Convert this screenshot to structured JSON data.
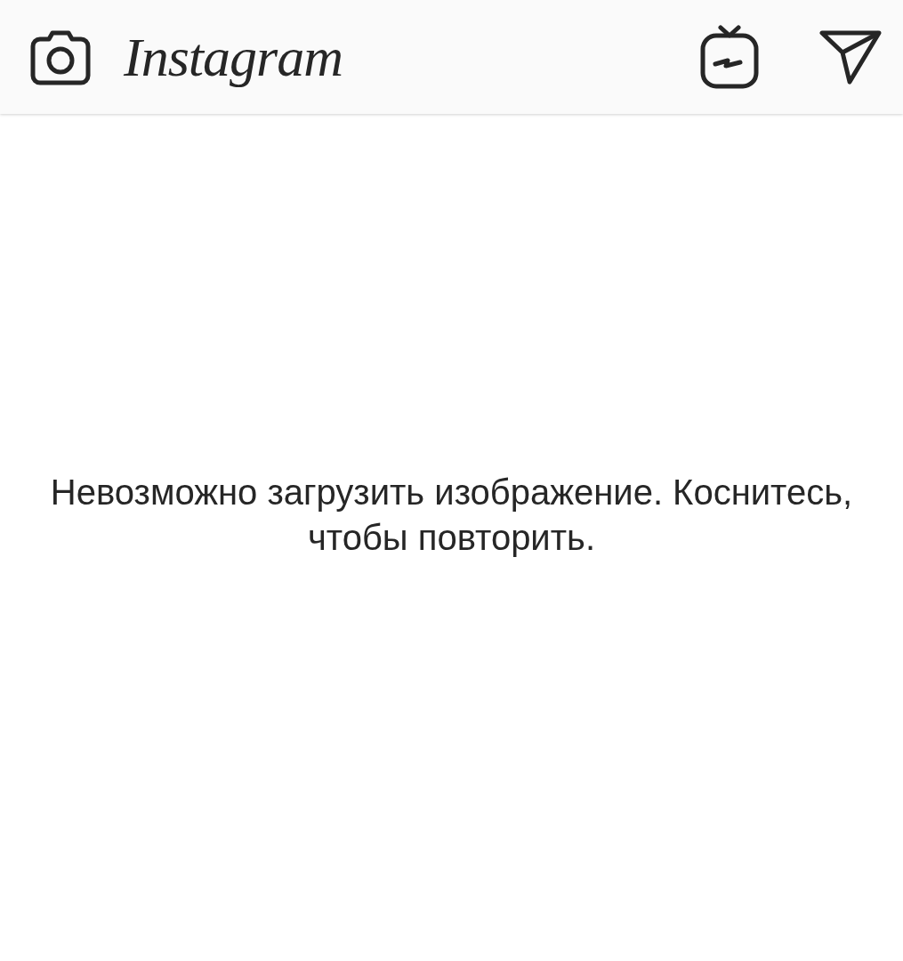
{
  "header": {
    "logo": "Instagram"
  },
  "message": {
    "line_1": "Невозможно загрузить изображение. Коснитесь,",
    "line_2": "чтобы повторить."
  }
}
